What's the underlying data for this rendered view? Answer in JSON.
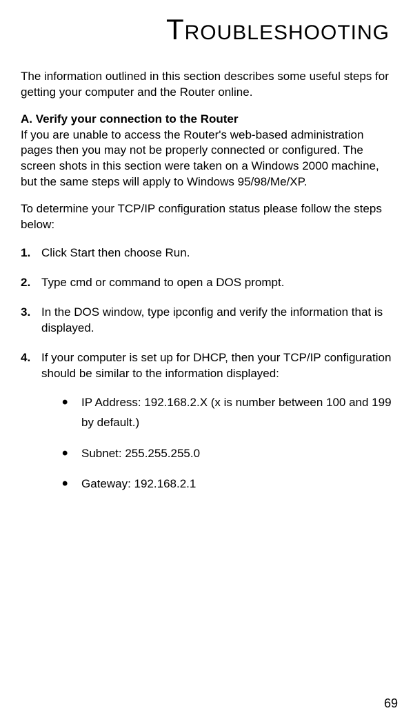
{
  "title": {
    "big_letter": "T",
    "rest": "ROUBLESHOOTING"
  },
  "intro": "The information outlined in this section describes some useful steps for getting your computer and the Router online.",
  "section": {
    "heading": "A. Verify your connection to the Router",
    "body": "If you are unable to access the Router's web-based administration pages then you may not be properly connected or configured. The screen shots in this section were taken on a Windows 2000 machine, but the same steps will apply to Windows 95/98/Me/XP."
  },
  "lead": "To determine your TCP/IP configuration status please follow the steps below:",
  "steps": [
    {
      "num": "1.",
      "text": "Click Start then choose Run."
    },
    {
      "num": "2.",
      "text": "Type cmd or command to open a DOS prompt."
    },
    {
      "num": "3.",
      "text": "In the DOS window, type ipconfig and verify the information that is displayed."
    },
    {
      "num": "4.",
      "text": "If your computer is set up for DHCP, then your TCP/IP configuration should be similar to the information displayed:"
    }
  ],
  "bullets": [
    "IP Address: 192.168.2.X (x is number between 100 and 199 by default.)",
    "Subnet: 255.255.255.0",
    "Gateway: 192.168.2.1"
  ],
  "page_number": "69"
}
